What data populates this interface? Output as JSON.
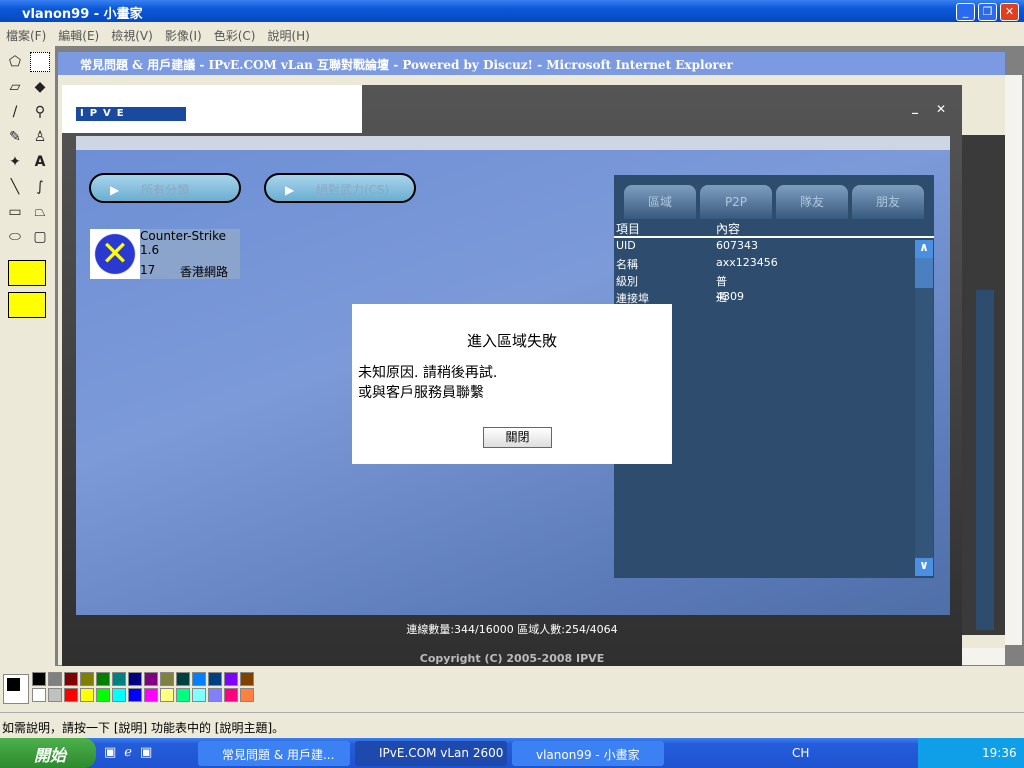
{
  "paint": {
    "title": "vlanon99 - 小畫家",
    "menu": [
      "檔案(F)",
      "編輯(E)",
      "檢視(V)",
      "影像(I)",
      "色彩(C)",
      "說明(H)"
    ],
    "status": "如需說明，請按一下 [說明] 功能表中的 [說明主題]。"
  },
  "ie": {
    "title": "常見問題 & 用戶建議 - IPvE.COM vLan 互聯對戰論壇 - Powered by Discuz! - Microsoft Internet Explorer"
  },
  "app": {
    "logo": "IPVE",
    "buttons": [
      "所有分類",
      "絕對武力(CS)"
    ],
    "game": {
      "name": "Counter-Strike 1.6",
      "count": "17",
      "region": "香港網路"
    },
    "tabs": [
      "區域",
      "P2P",
      "隊友",
      "朋友"
    ],
    "columns": [
      "項目",
      "內容"
    ],
    "rows": [
      {
        "k": "UID",
        "v": "607343"
      },
      {
        "k": "名稱",
        "v": "axx123456"
      },
      {
        "k": "級別",
        "v": "普通"
      },
      {
        "k": "連接埠",
        "v": "4309"
      }
    ],
    "stats": "連線數量:344/16000    區域人數:254/4064",
    "copyright": "Copyright (C) 2005-2008 IPVE"
  },
  "dialog": {
    "title": "進入區域失敗",
    "line1": "未知原因. 請稍後再試.",
    "line2": "或與客戶服務員聯繫",
    "close": "關閉"
  },
  "taskbar": {
    "start": "開始",
    "tasks": [
      "常見問題 & 用戶建...",
      "IPvE.COM vLan 2600",
      "vlanon99 - 小畫家"
    ],
    "lang": "CH",
    "clock": "19:36"
  },
  "colors": [
    "#000000",
    "#808080",
    "#800000",
    "#808000",
    "#008000",
    "#008080",
    "#000080",
    "#800080",
    "#808040",
    "#004040",
    "#0080ff",
    "#004080",
    "#8000ff",
    "#804000",
    "#ffffff",
    "#c0c0c0",
    "#ff0000",
    "#ffff00",
    "#00ff00",
    "#00ffff",
    "#0000ff",
    "#ff00ff",
    "#ffff80",
    "#00ff80",
    "#80ffff",
    "#8080ff",
    "#ff0080",
    "#ff8040"
  ]
}
